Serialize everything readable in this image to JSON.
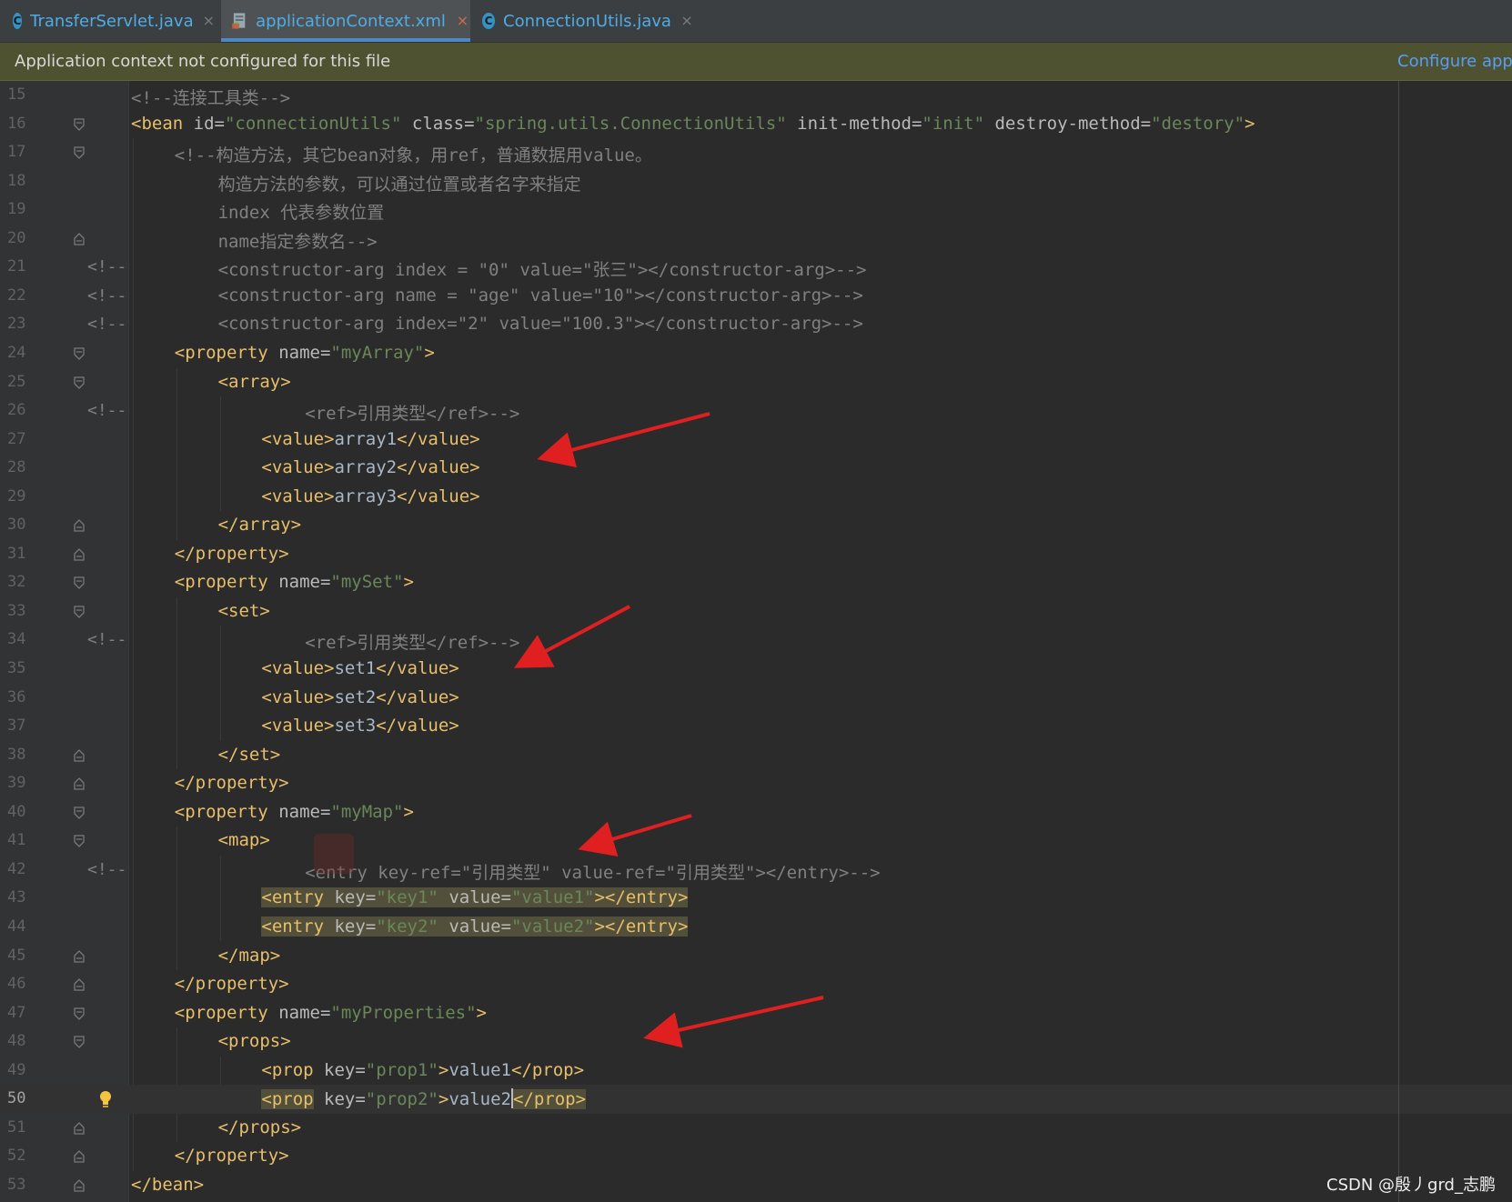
{
  "tabs": [
    {
      "label": "TransferServlet.java",
      "icon": "java-class-icon",
      "icon_letter": "C",
      "active": false
    },
    {
      "label": "applicationContext.xml",
      "icon": "spring-xml-icon",
      "active": true
    },
    {
      "label": "ConnectionUtils.java",
      "icon": "java-class-icon",
      "icon_letter": "C",
      "active": false
    }
  ],
  "close_glyph": "×",
  "banner": {
    "message": "Application context not configured for this file",
    "link": "Configure app"
  },
  "editor": {
    "current_line": 50,
    "line_numbers": [
      "15",
      "16",
      "17",
      "18",
      "19",
      "20",
      "21",
      "22",
      "23",
      "24",
      "25",
      "26",
      "27",
      "28",
      "29",
      "30",
      "31",
      "32",
      "33",
      "34",
      "35",
      "36",
      "37",
      "38",
      "39",
      "40",
      "41",
      "42",
      "43",
      "44",
      "45",
      "46",
      "47",
      "48",
      "49",
      "50",
      "51",
      "52",
      "53"
    ],
    "comment_marker": "<!--",
    "lines": [
      {
        "n": "15",
        "segs": [
          [
            "<!--连接工具类-->",
            "cmt"
          ]
        ]
      },
      {
        "n": "16",
        "segs": [
          [
            "<bean ",
            "tag"
          ],
          [
            "id=",
            "attr"
          ],
          [
            "\"connectionUtils\"",
            "val"
          ],
          [
            " class=",
            "attr"
          ],
          [
            "\"spring.utils.ConnectionUtils\"",
            "val"
          ],
          [
            " init-method=",
            "attr"
          ],
          [
            "\"init\"",
            "val"
          ],
          [
            " destroy-method=",
            "attr"
          ],
          [
            "\"destory\"",
            "val"
          ],
          [
            ">",
            "tag"
          ]
        ]
      },
      {
        "n": "17",
        "segs": [
          [
            "<!--构造方法，其它bean对象，用ref，普通数据用value。",
            "cmt"
          ]
        ]
      },
      {
        "n": "18",
        "segs": [
          [
            "构造方法的参数，可以通过位置或者名字来指定",
            "cmt"
          ]
        ]
      },
      {
        "n": "19",
        "segs": [
          [
            "index 代表参数位置",
            "cmt"
          ]
        ]
      },
      {
        "n": "20",
        "segs": [
          [
            "name指定参数名-->",
            "cmt"
          ]
        ]
      },
      {
        "n": "21",
        "segs": [
          [
            "<constructor-arg index = \"0\" value=\"张三\"></constructor-arg>-->",
            "cmt"
          ]
        ]
      },
      {
        "n": "22",
        "segs": [
          [
            "<constructor-arg name = \"age\" value=\"10\"></constructor-arg>-->",
            "cmt"
          ]
        ]
      },
      {
        "n": "23",
        "segs": [
          [
            "<constructor-arg index=\"2\" value=\"100.3\"></constructor-arg>-->",
            "cmt"
          ]
        ]
      },
      {
        "n": "24",
        "segs": [
          [
            "<property ",
            "tag"
          ],
          [
            "name=",
            "attr"
          ],
          [
            "\"myArray\"",
            "val"
          ],
          [
            ">",
            "tag"
          ]
        ]
      },
      {
        "n": "25",
        "segs": [
          [
            "<array>",
            "tag"
          ]
        ]
      },
      {
        "n": "26",
        "segs": [
          [
            "<ref>引用类型</ref>-->",
            "cmt"
          ]
        ]
      },
      {
        "n": "27",
        "segs": [
          [
            "<value>",
            "tag"
          ],
          [
            "array1",
            "text"
          ],
          [
            "</value>",
            "tag"
          ]
        ]
      },
      {
        "n": "28",
        "segs": [
          [
            "<value>",
            "tag"
          ],
          [
            "array2",
            "text"
          ],
          [
            "</value>",
            "tag"
          ]
        ]
      },
      {
        "n": "29",
        "segs": [
          [
            "<value>",
            "tag"
          ],
          [
            "array3",
            "text"
          ],
          [
            "</value>",
            "tag"
          ]
        ]
      },
      {
        "n": "30",
        "segs": [
          [
            "</array>",
            "tag"
          ]
        ]
      },
      {
        "n": "31",
        "segs": [
          [
            "</property>",
            "tag"
          ]
        ]
      },
      {
        "n": "32",
        "segs": [
          [
            "<property ",
            "tag"
          ],
          [
            "name=",
            "attr"
          ],
          [
            "\"mySet\"",
            "val"
          ],
          [
            ">",
            "tag"
          ]
        ]
      },
      {
        "n": "33",
        "segs": [
          [
            "<set>",
            "tag"
          ]
        ]
      },
      {
        "n": "34",
        "segs": [
          [
            "<ref>引用类型</ref>-->",
            "cmt"
          ]
        ]
      },
      {
        "n": "35",
        "segs": [
          [
            "<value>",
            "tag"
          ],
          [
            "set1",
            "text"
          ],
          [
            "</value>",
            "tag"
          ]
        ]
      },
      {
        "n": "36",
        "segs": [
          [
            "<value>",
            "tag"
          ],
          [
            "set2",
            "text"
          ],
          [
            "</value>",
            "tag"
          ]
        ]
      },
      {
        "n": "37",
        "segs": [
          [
            "<value>",
            "tag"
          ],
          [
            "set3",
            "text"
          ],
          [
            "</value>",
            "tag"
          ]
        ]
      },
      {
        "n": "38",
        "segs": [
          [
            "</set>",
            "tag"
          ]
        ]
      },
      {
        "n": "39",
        "segs": [
          [
            "</property>",
            "tag"
          ]
        ]
      },
      {
        "n": "40",
        "segs": [
          [
            "<property ",
            "tag"
          ],
          [
            "name=",
            "attr"
          ],
          [
            "\"myMap\"",
            "val"
          ],
          [
            ">",
            "tag"
          ]
        ]
      },
      {
        "n": "41",
        "segs": [
          [
            "<map>",
            "tag"
          ]
        ]
      },
      {
        "n": "42",
        "segs": [
          [
            "<entry key-ref=\"引用类型\" value-ref=\"引用类型\"></entry>-->",
            "cmt"
          ]
        ]
      },
      {
        "n": "43",
        "segs": [
          [
            "<entry ",
            "tag"
          ],
          [
            "key=",
            "attr"
          ],
          [
            "\"key1\"",
            "val"
          ],
          [
            " value=",
            "attr"
          ],
          [
            "\"value1\"",
            "val"
          ],
          [
            "></entry>",
            "tag"
          ]
        ]
      },
      {
        "n": "44",
        "segs": [
          [
            "<entry ",
            "tag"
          ],
          [
            "key=",
            "attr"
          ],
          [
            "\"key2\"",
            "val"
          ],
          [
            " value=",
            "attr"
          ],
          [
            "\"value2\"",
            "val"
          ],
          [
            "></entry>",
            "tag"
          ]
        ]
      },
      {
        "n": "45",
        "segs": [
          [
            "</map>",
            "tag"
          ]
        ]
      },
      {
        "n": "46",
        "segs": [
          [
            "</property>",
            "tag"
          ]
        ]
      },
      {
        "n": "47",
        "segs": [
          [
            "<property ",
            "tag"
          ],
          [
            "name=",
            "attr"
          ],
          [
            "\"myProperties\"",
            "val"
          ],
          [
            ">",
            "tag"
          ]
        ]
      },
      {
        "n": "48",
        "segs": [
          [
            "<props>",
            "tag"
          ]
        ]
      },
      {
        "n": "49",
        "segs": [
          [
            "<prop ",
            "tag"
          ],
          [
            "key=",
            "attr"
          ],
          [
            "\"prop1\"",
            "val"
          ],
          [
            ">",
            "tag"
          ],
          [
            "value1",
            "text"
          ],
          [
            "</prop>",
            "tag"
          ]
        ]
      },
      {
        "n": "50",
        "segs": [
          [
            "<prop",
            "tag"
          ],
          [
            " key=",
            "attr"
          ],
          [
            "\"prop2\"",
            "val"
          ],
          [
            ">",
            "tag"
          ],
          [
            "value2",
            "text"
          ],
          [
            "</prop>",
            "tag"
          ]
        ]
      },
      {
        "n": "51",
        "segs": [
          [
            "</props>",
            "tag"
          ]
        ]
      },
      {
        "n": "52",
        "segs": [
          [
            "</property>",
            "tag"
          ]
        ]
      },
      {
        "n": "53",
        "segs": [
          [
            "</bean>",
            "tag"
          ]
        ]
      }
    ]
  },
  "watermark": "CSDN @殷丿grd_志鹏",
  "colors": {
    "tag": "#e8bf6a",
    "attr": "#bababa",
    "value": "#6a8759",
    "comment": "#808080",
    "text": "#a9b7c6",
    "arrow": "#e02020",
    "banner_bg": "#4e5230",
    "link": "#589df6"
  }
}
